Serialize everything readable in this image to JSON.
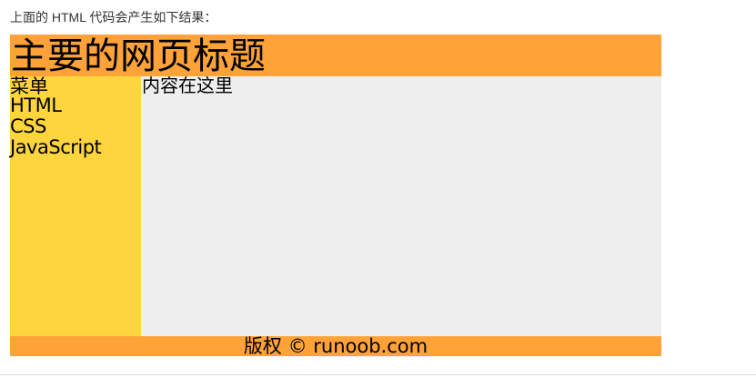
{
  "intro_text": "上面的 HTML 代码会产生如下结果：",
  "header": {
    "title": "主要的网页标题"
  },
  "menu": {
    "title": "菜单",
    "items": [
      "HTML",
      "CSS",
      "JavaScript"
    ]
  },
  "content": {
    "text": "内容在这里"
  },
  "footer": {
    "text": "版权 © runoob.com"
  },
  "colors": {
    "header_bg": "#FFA339",
    "menu_bg": "#FFD53E",
    "content_bg": "#EEEEEE",
    "footer_bg": "#FFA339"
  }
}
